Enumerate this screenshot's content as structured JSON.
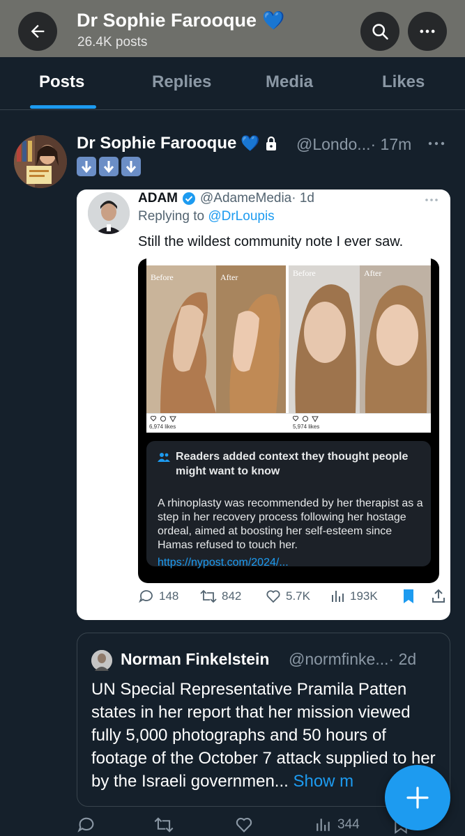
{
  "header": {
    "title": "Dr Sophie Farooque",
    "title_emoji": "💙",
    "subtitle": "26.4K posts"
  },
  "tabs": [
    {
      "label": "Posts",
      "active": true
    },
    {
      "label": "Replies",
      "active": false
    },
    {
      "label": "Media",
      "active": false
    },
    {
      "label": "Likes",
      "active": false
    }
  ],
  "post": {
    "author_name": "Dr Sophie Farooque",
    "author_emoji": "💙",
    "handle": "@Londo...",
    "time": "· 17m",
    "emojis": [
      "⬇️",
      "⬇️",
      "⬇️"
    ]
  },
  "embedded": {
    "author_name": "ADAM",
    "handle": "@AdameMedia",
    "time": "· 1d",
    "reply_prefix": "Replying to ",
    "reply_handle": "@DrLoupis",
    "text": "Still the wildest community note I ever saw.",
    "photos": {
      "label_before_1": "Before",
      "label_after_1": "After",
      "label_before_2": "Before",
      "label_after_2": "After",
      "likes_1": "6,974 likes",
      "likes_2": "5,974 likes"
    },
    "community_note": {
      "heading": "Readers added context they thought people might want to know",
      "body": "A rhinoplasty was recommended by her therapist as a step in her recovery process following her hostage ordeal, aimed at boosting her self-esteem since Hamas refused to touch her.",
      "link": "https://nypost.com/2024/..."
    },
    "actions": {
      "replies": "148",
      "reposts": "842",
      "likes": "5.7K",
      "views": "193K"
    }
  },
  "quote": {
    "author_name": "Norman Finkelstein",
    "handle": "@normfinke...",
    "time": "· 2d",
    "text": "UN Special Representative Pramila Patten states in her report that her mission viewed fully 5,000 photographs and 50 hours of footage of the October 7 attack supplied to her by the Israeli governmen...",
    "show_more": " Show m"
  },
  "bottom_actions": {
    "views": "344"
  },
  "colors": {
    "background": "#15202b",
    "header": "#6e6f6a",
    "accent": "#1d9bf0",
    "muted": "#8b98a5"
  }
}
